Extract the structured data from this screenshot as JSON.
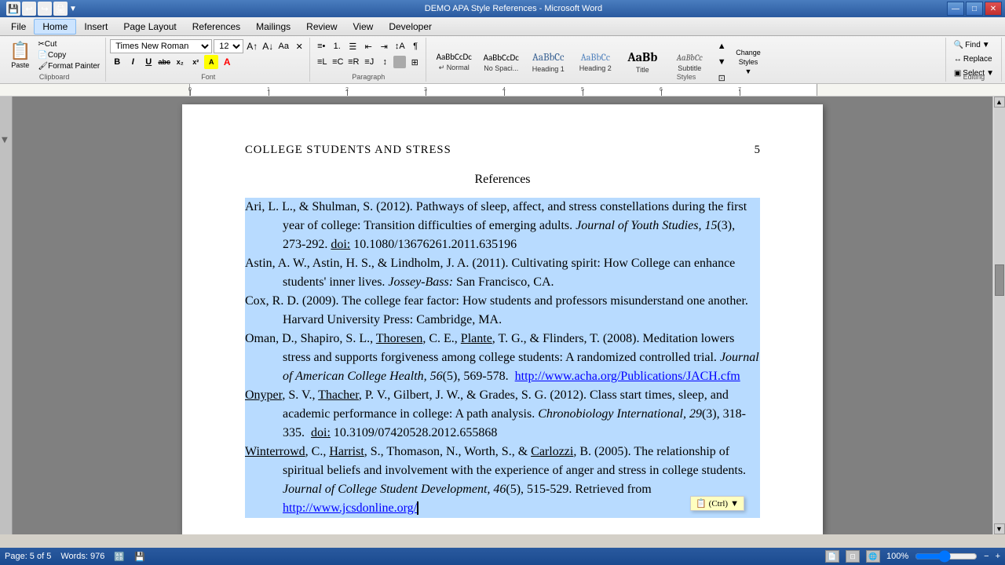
{
  "titlebar": {
    "title": "DEMO APA Style References - Microsoft Word",
    "minimize": "—",
    "maximize": "□",
    "close": "✕"
  },
  "menubar": {
    "items": [
      {
        "id": "file",
        "label": "File"
      },
      {
        "id": "home",
        "label": "Home",
        "active": true
      },
      {
        "id": "insert",
        "label": "Insert"
      },
      {
        "id": "page-layout",
        "label": "Page Layout"
      },
      {
        "id": "references",
        "label": "References"
      },
      {
        "id": "mailings",
        "label": "Mailings"
      },
      {
        "id": "review",
        "label": "Review"
      },
      {
        "id": "view",
        "label": "View"
      },
      {
        "id": "developer",
        "label": "Developer"
      }
    ]
  },
  "ribbon": {
    "clipboard": {
      "group_label": "Clipboard",
      "paste": "Paste",
      "cut": "Cut",
      "copy": "Copy",
      "format_painter": "Format Painter"
    },
    "font": {
      "group_label": "Font",
      "font_name": "Times New Roman",
      "font_size": "12",
      "bold": "B",
      "italic": "I",
      "underline": "U",
      "strikethrough": "abc",
      "subscript": "x₂",
      "superscript": "x²"
    },
    "paragraph": {
      "group_label": "Paragraph"
    },
    "styles": {
      "group_label": "Styles",
      "items": [
        {
          "id": "normal",
          "label": "Normal",
          "preview": "AaBbCcDc",
          "class": "normal"
        },
        {
          "id": "no-spacing",
          "label": "No Spaci...",
          "preview": "AaBbCcDc",
          "class": "no-spacing"
        },
        {
          "id": "heading1",
          "label": "Heading 1",
          "preview": "AaBbCc",
          "class": "heading1"
        },
        {
          "id": "heading2",
          "label": "Heading 2",
          "preview": "AaBbCc",
          "class": "heading2"
        },
        {
          "id": "title",
          "label": "Title",
          "preview": "AaBb",
          "class": "title"
        },
        {
          "id": "subtitle",
          "label": "Subtitle",
          "preview": "AaBbCc",
          "class": "subtitle"
        }
      ],
      "change_styles": "Change\nStyles"
    },
    "editing": {
      "group_label": "Editing",
      "find": "Find",
      "replace": "Replace",
      "select": "Select"
    }
  },
  "document": {
    "header_text": "COLLEGE STUDENTS AND STRESS",
    "page_number": "5",
    "section_heading": "References",
    "references": [
      {
        "id": 1,
        "text": "Ari, L. L., & Shulman, S. (2012). Pathways of sleep, affect, and stress constellations during the first year of college: Transition difficulties of emerging adults. Journal of Youth Studies, 15(3), 273-292. doi: 10.1080/13676261.2011.635196"
      },
      {
        "id": 2,
        "text": "Astin, A. W., Astin, H. S., & Lindholm, J. A. (2011). Cultivating spirit: How College can enhance students' inner lives. Jossey-Bass: San Francisco, CA."
      },
      {
        "id": 3,
        "text": "Cox, R. D. (2009). The college fear factor: How students and professors misunderstand one another. Harvard University Press: Cambridge, MA."
      },
      {
        "id": 4,
        "text": "Oman, D., Shapiro, S. L., Thoresen, C. E., Plante, T. G., & Flinders, T. (2008). Meditation lowers stress and supports forgiveness among college students: A randomized controlled trial. Journal of American College Health, 56(5), 569-578.",
        "link": "http://www.acha.org/Publications/JACH.cfm"
      },
      {
        "id": 5,
        "text": "Onyper, S. V., Thacher, P. V., Gilbert, J. W., & Grades, S. G. (2012). Class start times, sleep, and academic performance in college: A path analysis. Chronobiology International, 29(3), 318-335.",
        "doi": "doi: 10.3109/07420528.2012.655868"
      },
      {
        "id": 6,
        "text": "Winterrowd, C., Harrist, S., Thomason, N., Worth, S., & Carlozzi, B. (2005). The relationship of spiritual beliefs and involvement with the experience of anger and stress in college students. Journal of College Student Development, 46(5), 515-529. Retrieved from",
        "link2": "http://www.jcsdonline.org/"
      }
    ],
    "paste_ctrl": "(Ctrl)"
  },
  "statusbar": {
    "page_info": "Page: 5 of 5",
    "words": "Words: 976",
    "zoom": "100%",
    "view_icons": [
      "print-view",
      "full-screen-reading",
      "web-layout"
    ]
  }
}
